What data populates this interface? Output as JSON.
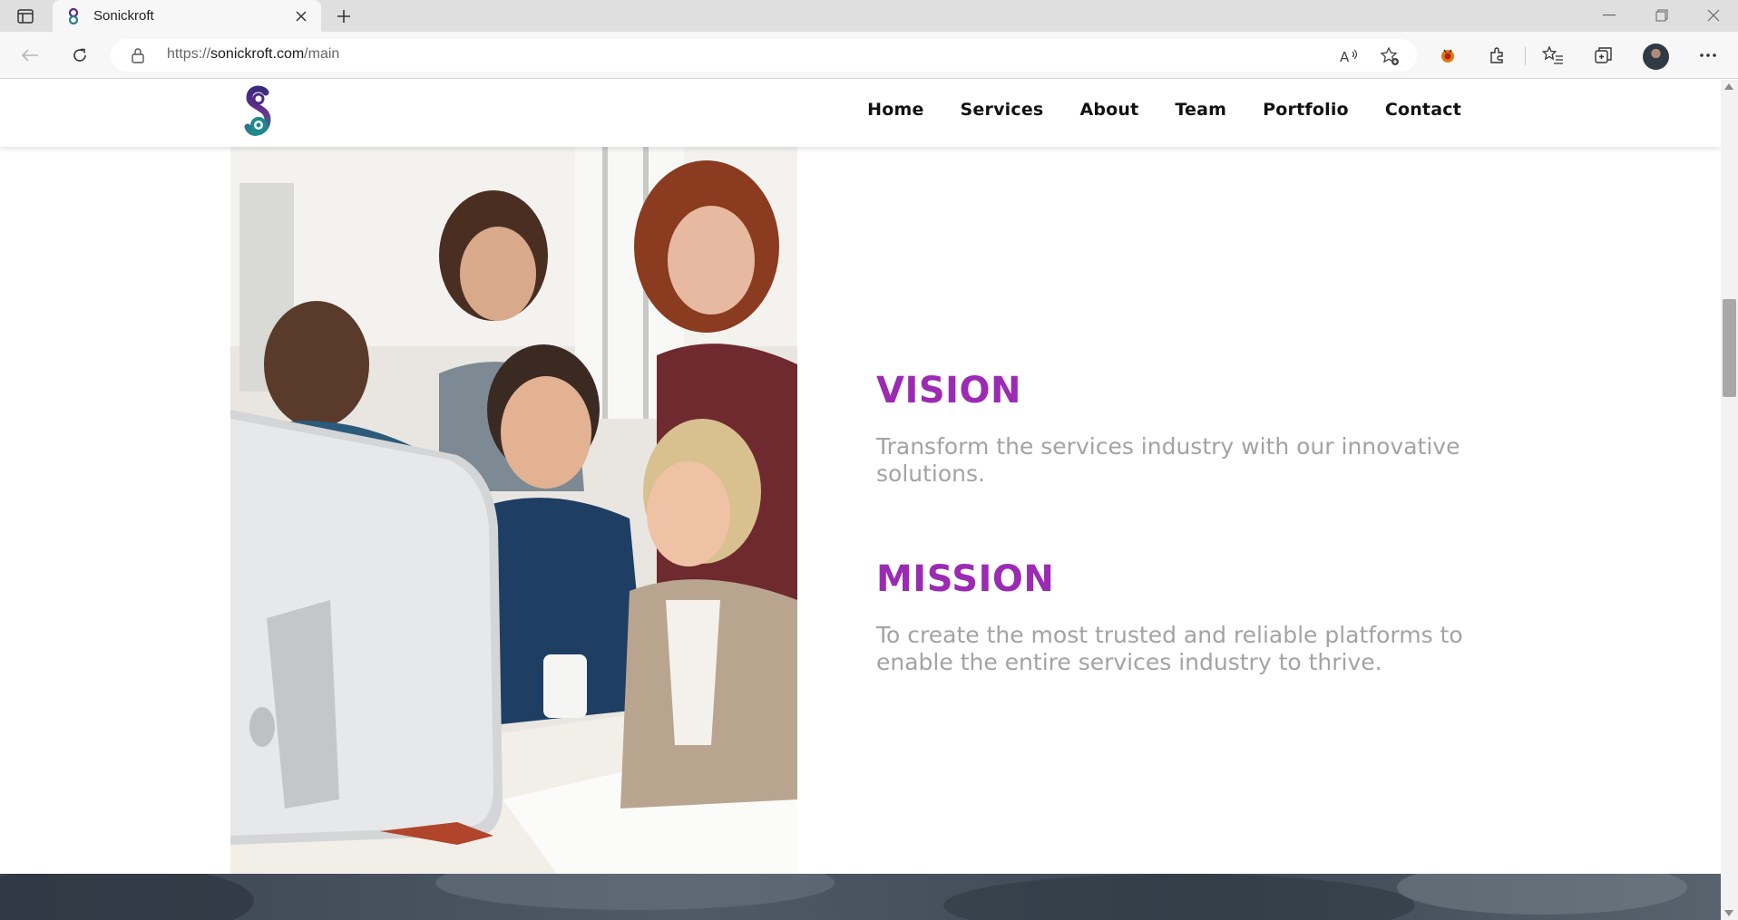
{
  "browser": {
    "tab_title": "Sonickroft",
    "url_prefix": "https://",
    "url_host": "sonickroft.com",
    "url_path": "/main"
  },
  "site": {
    "nav": [
      {
        "label": "Home"
      },
      {
        "label": "Services"
      },
      {
        "label": "About"
      },
      {
        "label": "Team"
      },
      {
        "label": "Portfolio"
      },
      {
        "label": "Contact"
      }
    ],
    "vision": {
      "title": "VISION",
      "text": "Transform the services industry with our innovative solutions."
    },
    "mission": {
      "title": "MISSION",
      "text": "To create the most trusted and reliable platforms to enable the entire services industry to thrive."
    }
  },
  "colors": {
    "accent": "#9b2bb3",
    "body_text": "#a3a3a3",
    "nav_text": "#111111"
  },
  "icons": {
    "tab_actions": "tab-actions-icon",
    "close_tab": "close-icon",
    "new_tab": "plus-icon",
    "back": "arrow-left-icon",
    "refresh": "refresh-icon",
    "site_info": "lock-icon",
    "read_aloud": "read-aloud-icon",
    "favorite": "star-add-icon",
    "extension": "puzzle-icon",
    "favorites": "favorites-list-icon",
    "collections": "collections-icon",
    "menu": "more-icon"
  }
}
